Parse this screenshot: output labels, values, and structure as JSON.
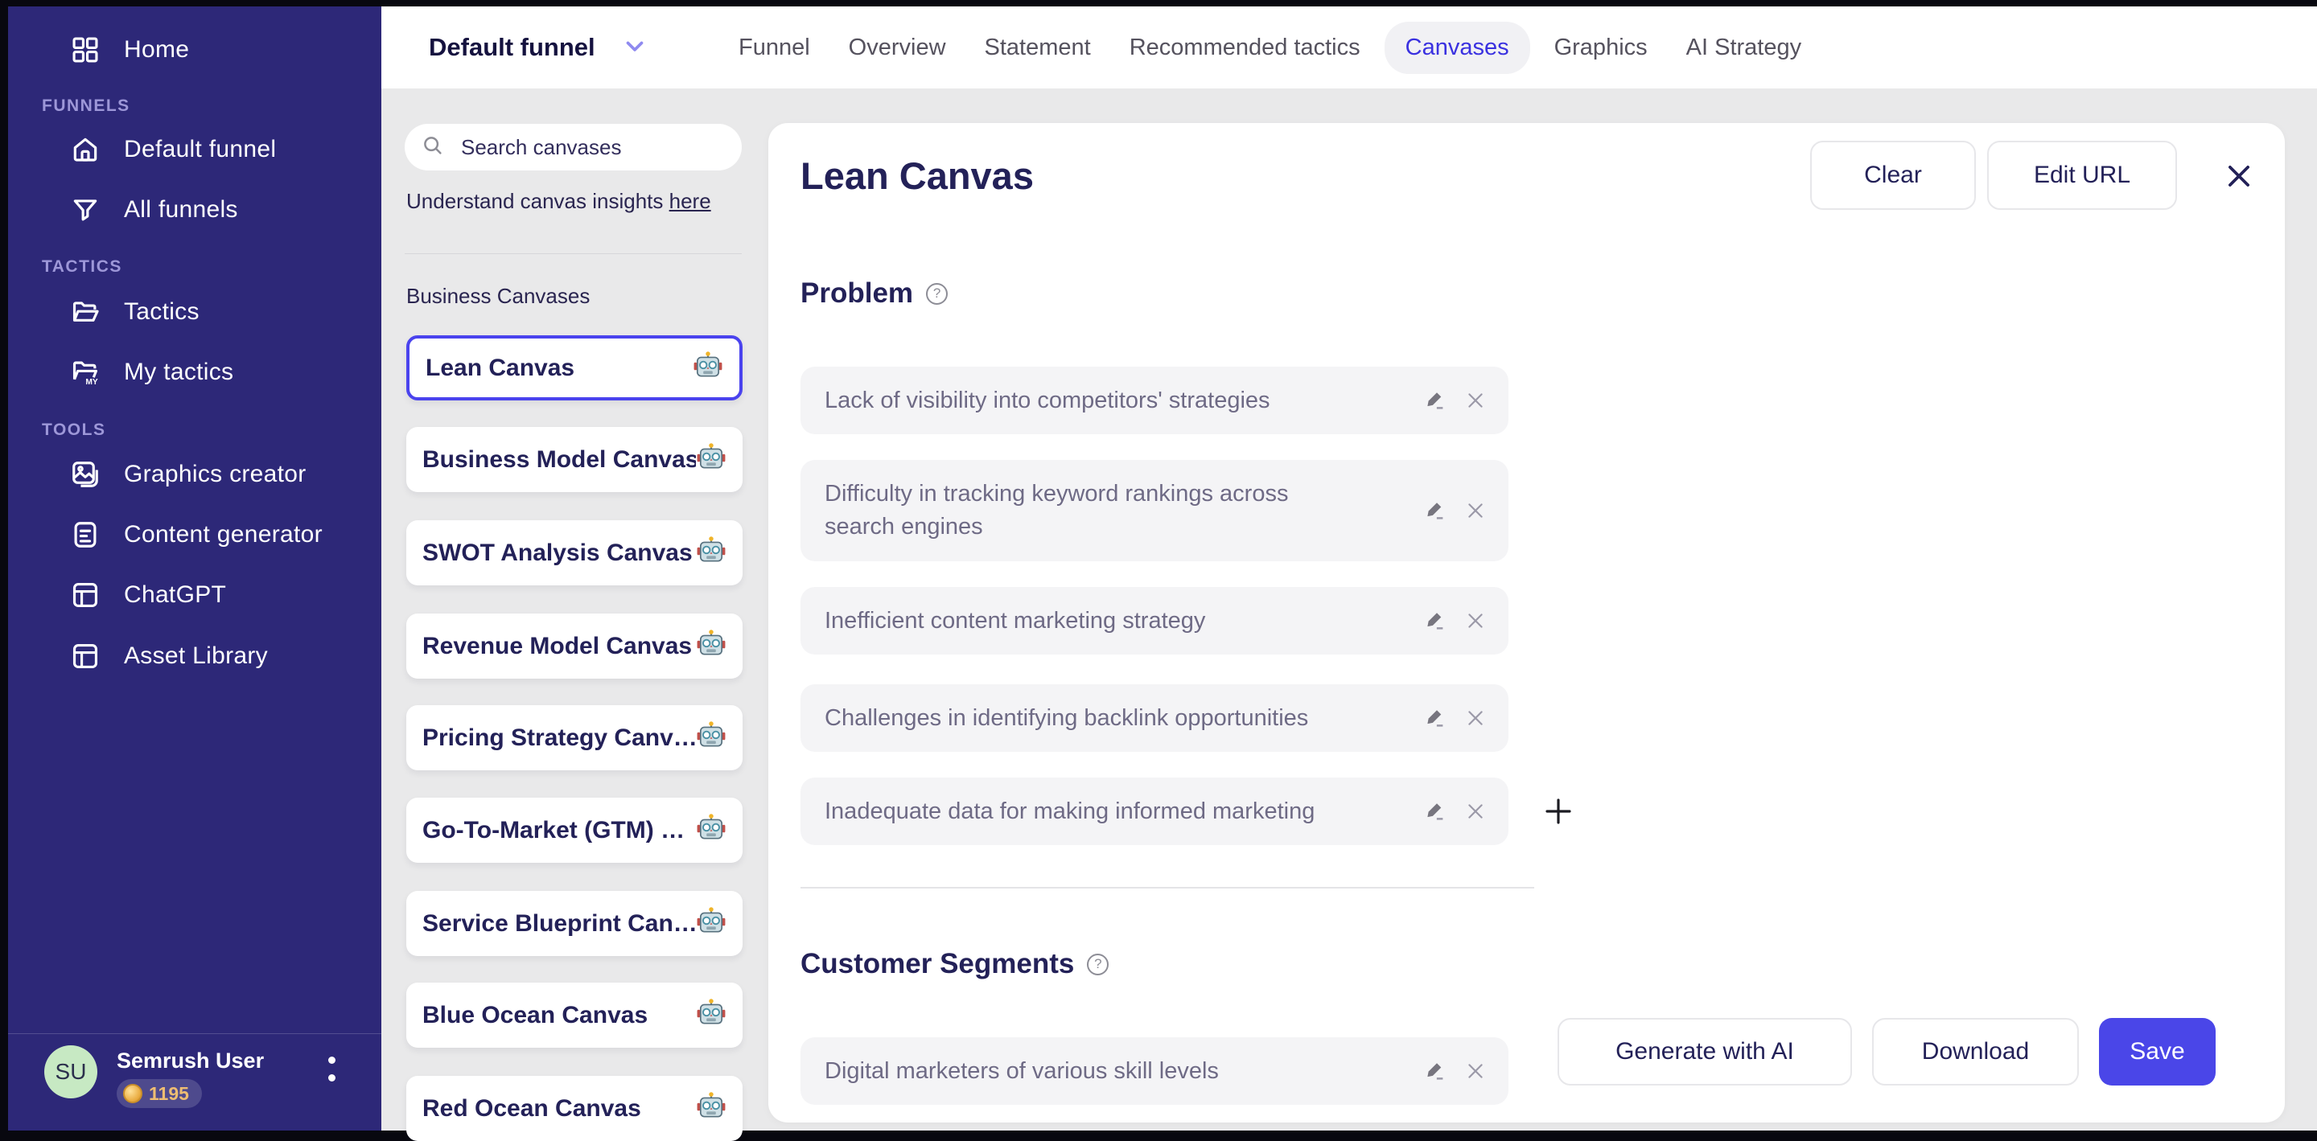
{
  "colors": {
    "sidebar_bg": "#2d2878",
    "accent": "#4a43ee",
    "active_tab": "#3a31e0",
    "save_bg": "#4a46e8",
    "item_bg": "#f4f4f6",
    "heading_text": "#232158"
  },
  "sidebar": {
    "home_label": "Home",
    "sections": [
      {
        "label": "FUNNELS"
      },
      {
        "label": "TACTICS"
      },
      {
        "label": "TOOLS"
      }
    ],
    "items": {
      "default_funnel": "Default funnel",
      "all_funnels": "All funnels",
      "tactics": "Tactics",
      "my_tactics": "My tactics",
      "graphics_creator": "Graphics creator",
      "content_generator": "Content generator",
      "chatgpt": "ChatGPT",
      "asset_library": "Asset Library"
    },
    "user": {
      "initials": "SU",
      "name": "Semrush User",
      "credits": "1195"
    }
  },
  "topbar": {
    "funnel_selector": "Default funnel",
    "tabs": [
      {
        "label": "Funnel"
      },
      {
        "label": "Overview"
      },
      {
        "label": "Statement"
      },
      {
        "label": "Recommended tactics"
      },
      {
        "label": "Canvases",
        "active": true
      },
      {
        "label": "Graphics"
      },
      {
        "label": "AI Strategy"
      }
    ]
  },
  "canvas_list": {
    "search_placeholder": "Search canvases",
    "insights_text": "Understand canvas insights ",
    "insights_link": "here",
    "group_label": "Business Canvases",
    "items": [
      {
        "label": "Lean Canvas",
        "selected": true
      },
      {
        "label": "Business Model Canvas"
      },
      {
        "label": "SWOT Analysis Canvas"
      },
      {
        "label": "Revenue Model Canvas"
      },
      {
        "label": "Pricing Strategy Canv…"
      },
      {
        "label": "Go-To-Market (GTM) …"
      },
      {
        "label": "Service Blueprint Can…"
      },
      {
        "label": "Blue Ocean Canvas"
      },
      {
        "label": "Red Ocean Canvas"
      }
    ]
  },
  "main": {
    "title": "Lean Canvas",
    "clear_label": "Clear",
    "edit_url_label": "Edit URL",
    "problem": {
      "heading": "Problem",
      "items": [
        "Lack of visibility into competitors' strategies",
        "Difficulty in tracking keyword rankings across search engines",
        "Inefficient content marketing strategy",
        "Challenges in identifying backlink opportunities",
        "Inadequate data for making informed marketing"
      ]
    },
    "customer_segments": {
      "heading": "Customer Segments",
      "items": [
        "Digital marketers of various skill levels"
      ]
    },
    "footer": {
      "generate_label": "Generate with AI",
      "download_label": "Download",
      "save_label": "Save"
    }
  }
}
